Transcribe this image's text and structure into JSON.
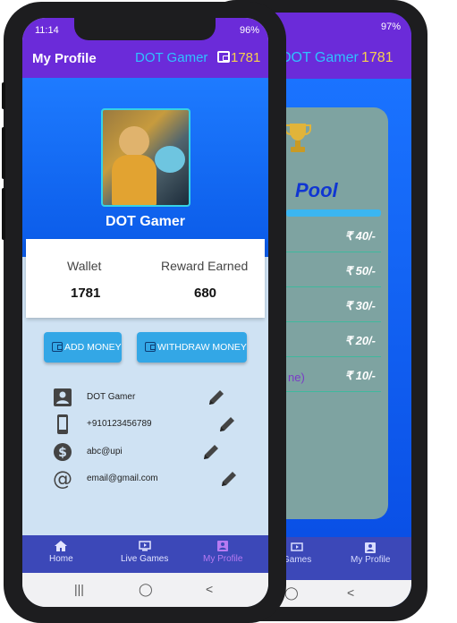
{
  "front": {
    "status": {
      "time": "11:14",
      "battery": "96%"
    },
    "header": {
      "title": "My Profile",
      "username": "DOT Gamer",
      "coins": "1781"
    },
    "profile": {
      "display_name": "DOT Gamer"
    },
    "stats": {
      "wallet_label": "Wallet",
      "wallet_value": "1781",
      "reward_label": "Reward Earned",
      "reward_value": "680"
    },
    "actions": {
      "add_money": "ADD MONEY",
      "withdraw_money": "WITHDRAW MONEY"
    },
    "info": {
      "name": "DOT Gamer",
      "phone": "+910123456789",
      "upi": "abc@upi",
      "email": "email@gmail.com"
    },
    "nav": {
      "home": "Home",
      "live_games": "Live Games",
      "my_profile": "My Profile"
    },
    "system_nav": {
      "recents": "|||",
      "home": "◯",
      "back": "<"
    }
  },
  "back": {
    "status": {
      "battery": "97%"
    },
    "header": {
      "username": "DOT Gamer",
      "coins": "1781"
    },
    "pool": {
      "title": "Pool",
      "prizes": [
        "₹ 40/-",
        "₹ 50/-",
        "₹ 30/-",
        "₹ 20/-",
        "₹ 10/-"
      ],
      "note": "ne)"
    },
    "nav": {
      "live_games": "Games",
      "my_profile": "My Profile"
    }
  },
  "colors": {
    "accent": "#6b2bd9",
    "primary_blue": "#0a5ae8",
    "username_blue": "#2fc2ff",
    "coins_gold": "#f6d04d",
    "nav_bg": "#3c48b8",
    "nav_active": "#b77af2"
  },
  "icons": [
    "wallet-icon",
    "person-icon",
    "phone-icon",
    "dollar-icon",
    "at-icon",
    "pencil-icon",
    "home-icon",
    "tv-icon",
    "profile-icon",
    "trophy-icon"
  ]
}
